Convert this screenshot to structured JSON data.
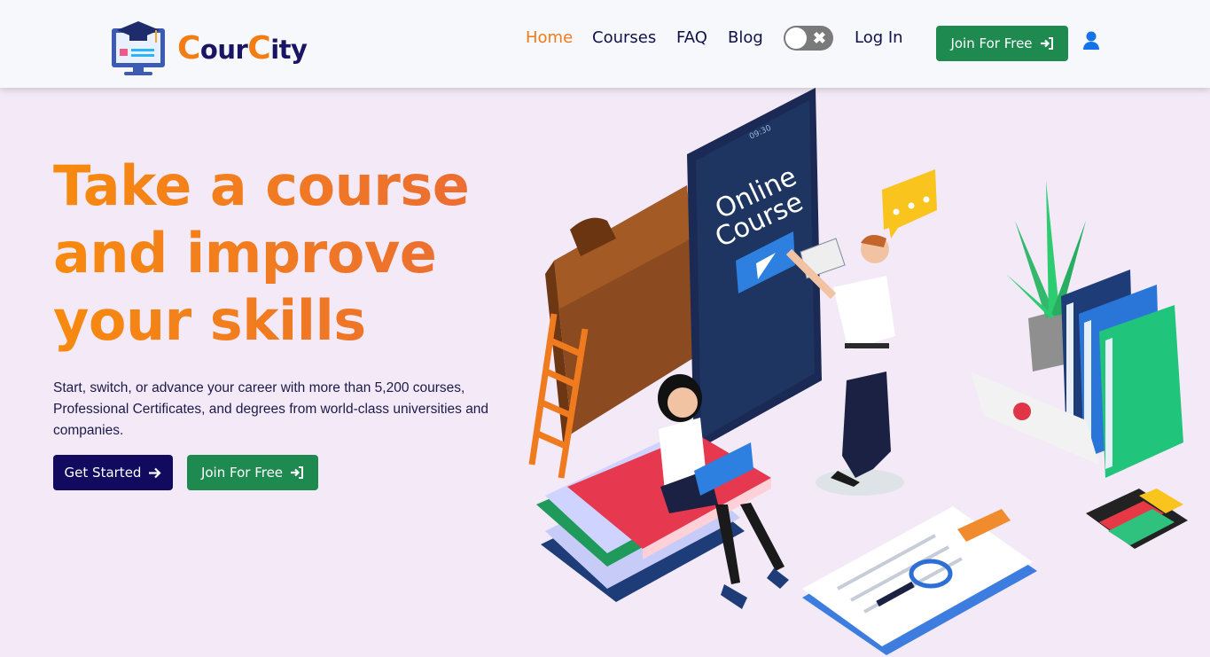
{
  "brand": {
    "first_letter": "C",
    "part1": "our",
    "second_letter": "C",
    "part2": "ity"
  },
  "nav": {
    "items": [
      {
        "label": "Home",
        "active": true
      },
      {
        "label": "Courses"
      },
      {
        "label": "FAQ"
      },
      {
        "label": "Blog"
      }
    ],
    "login_label": "Log In",
    "join_label": "Join For Free",
    "theme_toggle": {
      "state": "off",
      "icon": "close-icon"
    }
  },
  "hero": {
    "title_lines": [
      "Take a course",
      "and improve",
      "your skills"
    ],
    "subtitle": "Start, switch, or advance your career with more than 5,200 courses, Professional Certificates, and degrees from world-class universities and companies.",
    "primary_button": "Get Started",
    "secondary_button": "Join For Free"
  },
  "illustration": {
    "screen_text_1": "Online",
    "screen_text_2": "Course",
    "phone_time": "09:30"
  },
  "colors": {
    "accent_orange": "#f07a1a",
    "navy": "#110a5e",
    "green": "#1f8a50",
    "background": "#f3e9f7"
  }
}
